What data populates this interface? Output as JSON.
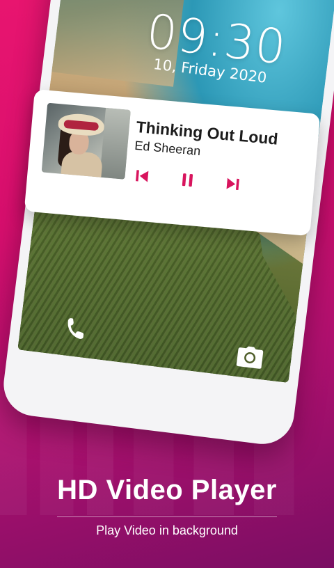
{
  "lockscreen": {
    "time": "09:30",
    "date": "10, Friday 2020"
  },
  "now_playing": {
    "title": "Thinking Out Loud",
    "artist": "Ed Sheeran",
    "controls": [
      "previous-icon",
      "pause-icon",
      "next-icon"
    ]
  },
  "promo": {
    "headline": "HD Video Player",
    "subtitle": "Play Video in background"
  },
  "colors": {
    "accent": "#d8145d",
    "background_top": "#e8156f",
    "background_bottom": "#7a0e63"
  }
}
